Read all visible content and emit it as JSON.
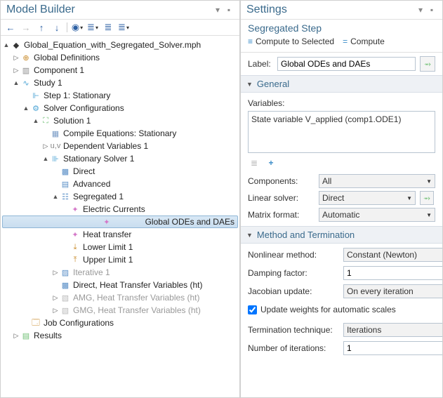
{
  "left": {
    "title": "Model Builder",
    "root": "Global_Equation_with_Segregated_Solver.mph",
    "nodes": {
      "globalDef": "Global Definitions",
      "component1": "Component 1",
      "study1": "Study 1",
      "step1": "Step 1: Stationary",
      "solverConfigs": "Solver Configurations",
      "solution1": "Solution 1",
      "compileEq": "Compile Equations: Stationary",
      "depVars": "Dependent Variables 1",
      "statSolver1": "Stationary Solver 1",
      "direct": "Direct",
      "advanced": "Advanced",
      "segregated1": "Segregated 1",
      "electricCurrents": "Electric Currents",
      "globalODEs": "Global ODEs and DAEs",
      "heatTransfer": "Heat transfer",
      "lowerLimit": "Lower Limit 1",
      "upperLimit": "Upper Limit 1",
      "iterative1": "Iterative 1",
      "directHT": "Direct, Heat Transfer Variables (ht)",
      "amgHT": "AMG, Heat Transfer Variables (ht)",
      "gmgHT": "GMG, Heat Transfer Variables (ht)",
      "jobConfigs": "Job Configurations",
      "results": "Results"
    }
  },
  "right": {
    "title": "Settings",
    "subtitle": "Segregated Step",
    "cmd1": "Compute to Selected",
    "cmd2": "Compute",
    "labelField": "Label:",
    "labelValue": "Global ODEs and DAEs",
    "section1": "General",
    "varsLabel": "Variables:",
    "varsValue": "State variable V_applied (comp1.ODE1)",
    "componentsLabel": "Components:",
    "componentsValue": "All",
    "linearSolverLabel": "Linear solver:",
    "linearSolverValue": "Direct",
    "matrixFormatLabel": "Matrix format:",
    "matrixFormatValue": "Automatic",
    "section2": "Method and Termination",
    "nonlinearLabel": "Nonlinear method:",
    "nonlinearValue": "Constant (Newton)",
    "dampingLabel": "Damping factor:",
    "dampingValue": "1",
    "jacobianLabel": "Jacobian update:",
    "jacobianValue": "On every iteration",
    "updateWeights": "Update weights for automatic scales",
    "termTechLabel": "Termination technique:",
    "termTechValue": "Iterations",
    "numIterLabel": "Number of iterations:",
    "numIterValue": "1"
  }
}
